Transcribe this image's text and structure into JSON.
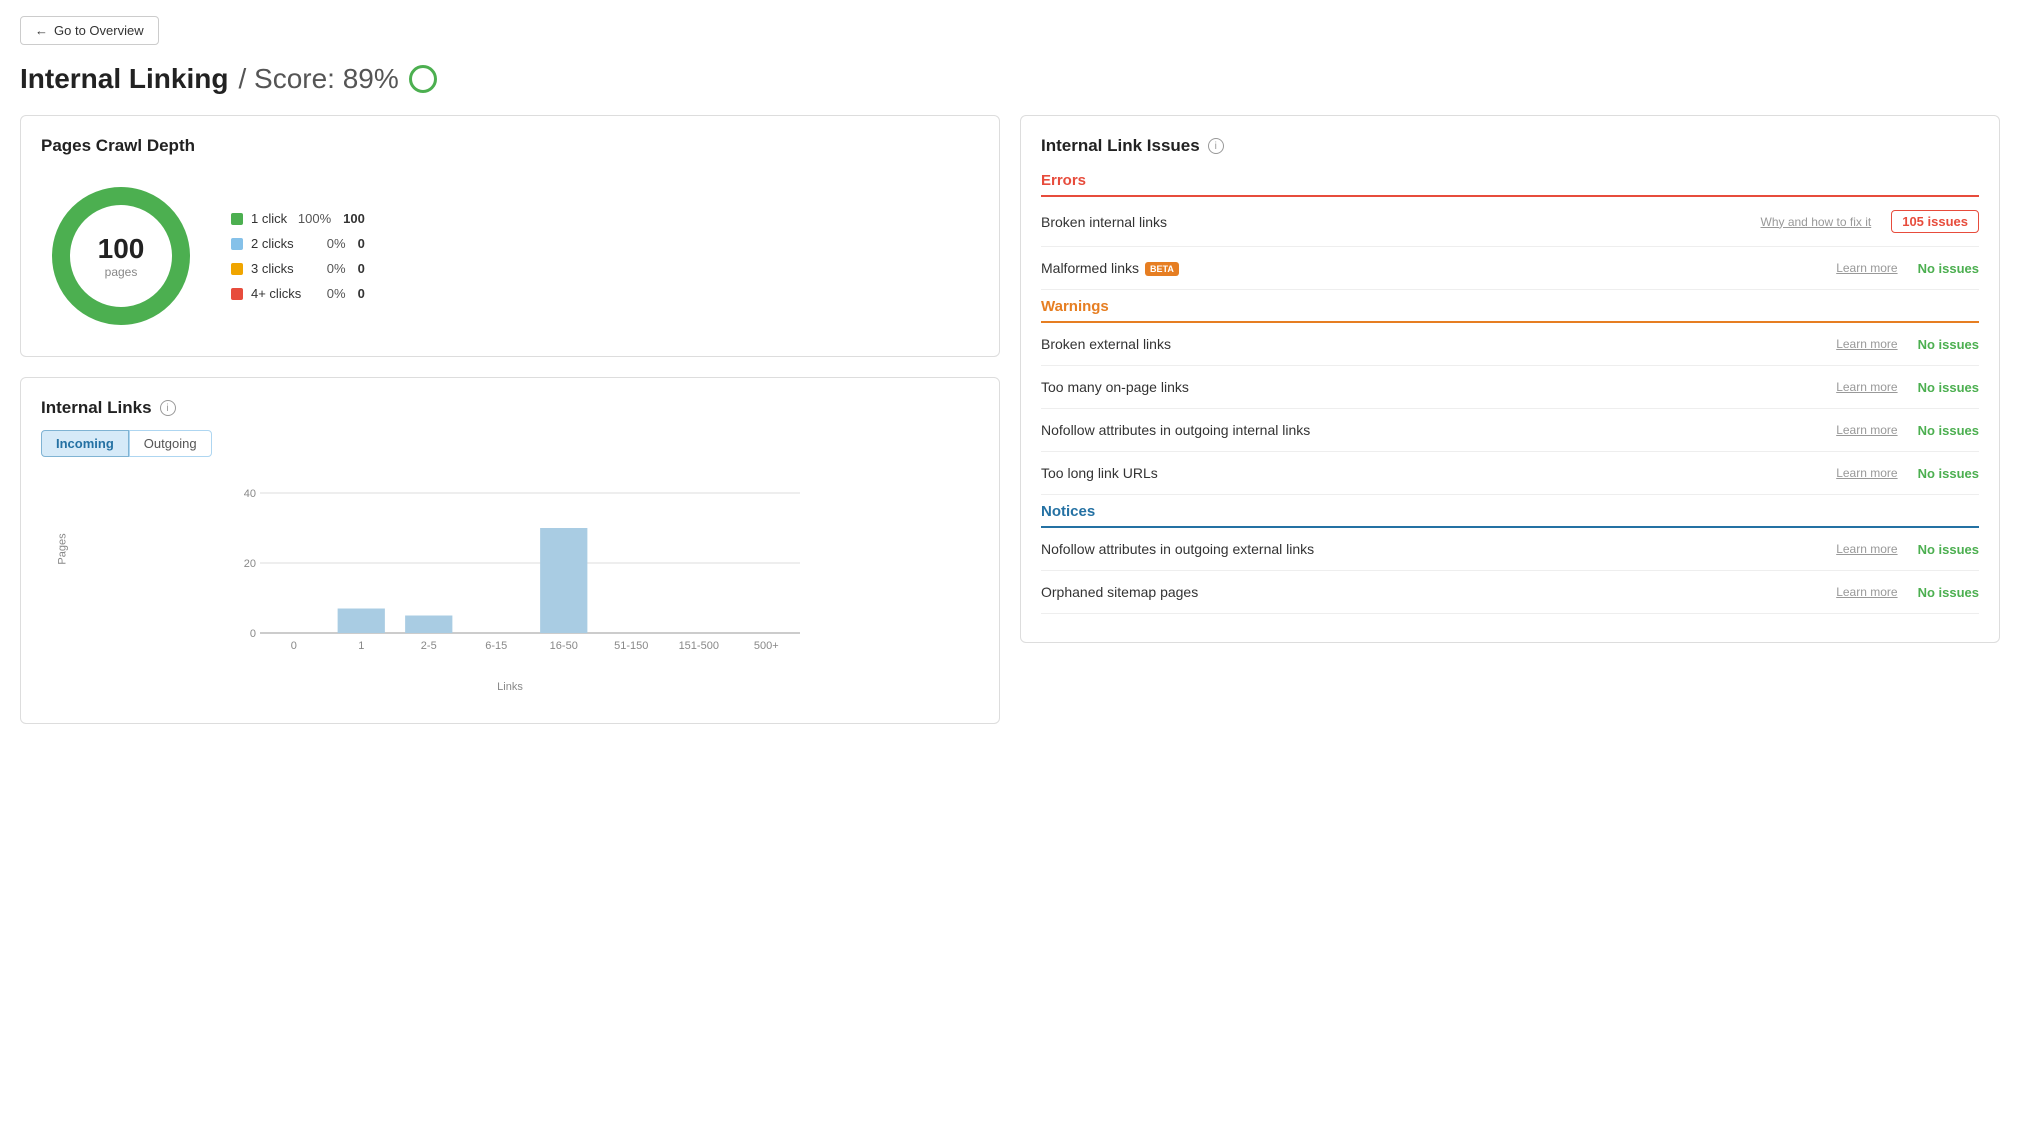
{
  "nav": {
    "back_label": "Go to Overview"
  },
  "header": {
    "title": "Internal Linking",
    "score_label": "/ Score: 89%"
  },
  "crawl_depth": {
    "title": "Pages Crawl Depth",
    "center_number": "100",
    "center_label": "pages",
    "legend": [
      {
        "label": "1 click",
        "color": "#4caf50",
        "pct": "100%",
        "count": "100"
      },
      {
        "label": "2 clicks",
        "color": "#85c1e9",
        "pct": "0%",
        "count": "0"
      },
      {
        "label": "3 clicks",
        "color": "#f0a500",
        "pct": "0%",
        "count": "0"
      },
      {
        "label": "4+ clicks",
        "color": "#e74c3c",
        "pct": "0%",
        "count": "0"
      }
    ]
  },
  "internal_links": {
    "title": "Internal Links",
    "tabs": [
      "Incoming",
      "Outgoing"
    ],
    "active_tab": "Incoming",
    "y_axis_label": "Pages",
    "x_axis_label": "Links",
    "y_ticks": [
      "0",
      "20",
      "40"
    ],
    "x_labels": [
      "0",
      "1",
      "2-5",
      "6-15",
      "16-50",
      "51-150",
      "151-500",
      "500+"
    ],
    "bars": [
      {
        "label": "0",
        "value": 0
      },
      {
        "label": "1",
        "value": 7
      },
      {
        "label": "2-5",
        "value": 5
      },
      {
        "label": "6-15",
        "value": 0
      },
      {
        "label": "16-50",
        "value": 30
      },
      {
        "label": "51-150",
        "value": 0
      },
      {
        "label": "151-500",
        "value": 0
      },
      {
        "label": "500+",
        "value": 0
      }
    ]
  },
  "issues_panel": {
    "title": "Internal Link Issues",
    "sections": [
      {
        "type": "errors",
        "label": "Errors",
        "items": [
          {
            "name": "Broken internal links",
            "learn_text": "Why and how to fix it",
            "count_text": "105 issues",
            "count_type": "has-issues"
          },
          {
            "name": "Malformed links",
            "beta": true,
            "learn_text": "Learn more",
            "count_text": "No issues",
            "count_type": "no-issues"
          }
        ]
      },
      {
        "type": "warnings",
        "label": "Warnings",
        "items": [
          {
            "name": "Broken external links",
            "learn_text": "Learn more",
            "count_text": "No issues",
            "count_type": "no-issues"
          },
          {
            "name": "Too many on-page links",
            "learn_text": "Learn more",
            "count_text": "No issues",
            "count_type": "no-issues"
          },
          {
            "name": "Nofollow attributes in outgoing internal links",
            "learn_text": "Learn more",
            "count_text": "No issues",
            "count_type": "no-issues"
          },
          {
            "name": "Too long link URLs",
            "learn_text": "Learn more",
            "count_text": "No issues",
            "count_type": "no-issues"
          }
        ]
      },
      {
        "type": "notices",
        "label": "Notices",
        "items": [
          {
            "name": "Nofollow attributes in outgoing external links",
            "learn_text": "Learn more",
            "count_text": "No issues",
            "count_type": "no-issues"
          },
          {
            "name": "Orphaned sitemap pages",
            "learn_text": "Learn more",
            "count_text": "No issues",
            "count_type": "no-issues"
          }
        ]
      }
    ]
  }
}
